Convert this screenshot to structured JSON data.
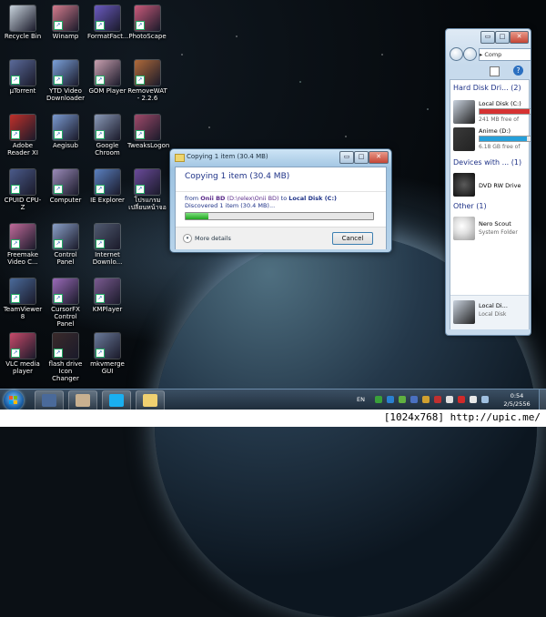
{
  "desktop": {
    "icons": [
      {
        "label": "Recycle Bin",
        "color": "#c8d3dc",
        "icon": "recycle-bin-icon"
      },
      {
        "label": "Winamp",
        "color": "#d37b8c",
        "icon": "winamp-icon"
      },
      {
        "label": "FormatFact...",
        "color": "#6a5ac0",
        "icon": "format-factory-icon"
      },
      {
        "label": "PhotoScape",
        "color": "#c95a7a",
        "icon": "photoscape-icon"
      },
      {
        "label": "µTorrent",
        "color": "#5a6a9a",
        "icon": "utorrent-icon"
      },
      {
        "label": "YTD Video Downloader",
        "color": "#7aa0d8",
        "icon": "ytd-icon"
      },
      {
        "label": "GOM Player",
        "color": "#c9a0b0",
        "icon": "gom-player-icon"
      },
      {
        "label": "RemoveWAT - 2.2.6",
        "color": "#b06a3a",
        "icon": "removewat-icon"
      },
      {
        "label": "Adobe Reader XI",
        "color": "#c0302a",
        "icon": "adobe-reader-icon"
      },
      {
        "label": "Aegisub",
        "color": "#7a9ad0",
        "icon": "aegisub-icon"
      },
      {
        "label": "Google Chroom",
        "color": "#8a9ab8",
        "icon": "google-chrome-icon"
      },
      {
        "label": "TweaksLogon",
        "color": "#a04a6a",
        "icon": "tweakslogon-icon"
      },
      {
        "label": "CPUID CPU-Z",
        "color": "#4a5a8a",
        "icon": "cpuz-icon"
      },
      {
        "label": "Computer",
        "color": "#9a8ab8",
        "icon": "computer-icon"
      },
      {
        "label": "IE Explorer",
        "color": "#5a80c0",
        "icon": "ie-explorer-icon"
      },
      {
        "label": "โปรแกรม เปลี่ยนหน้าจอ",
        "color": "#6a4a9a",
        "icon": "thai-program-icon"
      },
      {
        "label": "Freemake Video C...",
        "color": "#c06a9a",
        "icon": "freemake-icon"
      },
      {
        "label": "Control Panel",
        "color": "#8aa0c8",
        "icon": "control-panel-icon"
      },
      {
        "label": "Internet Downlo...",
        "color": "#505a70",
        "icon": "idm-icon"
      },
      {
        "label": "",
        "color": "",
        "icon": ""
      },
      {
        "label": "TeamViewer 8",
        "color": "#4a6a9a",
        "icon": "teamviewer-icon"
      },
      {
        "label": "CursorFX Control Panel",
        "color": "#9a6ab8",
        "icon": "cursorfx-icon"
      },
      {
        "label": "KMPlayer",
        "color": "#7a5a90",
        "icon": "kmplayer-icon"
      },
      {
        "label": "",
        "color": "",
        "icon": ""
      },
      {
        "label": "VLC media player",
        "color": "#c84a6a",
        "icon": "vlc-icon"
      },
      {
        "label": "flash drive Icon Changer",
        "color": "#3a2a2a",
        "icon": "flash-drive-icon"
      },
      {
        "label": "mkvmerge GUI",
        "color": "#6a7a9a",
        "icon": "mkvmerge-icon"
      }
    ]
  },
  "copy_dialog": {
    "title": "Copying 1 item (30.4 MB)",
    "heading": "Copying 1 item (30.4 MB)",
    "from_prefix": "from ",
    "source_name": "Onii BD",
    "source_path": " (D:\\relex\\Onii BD)",
    "to_word": " to ",
    "dest": "Local Disk (C:)",
    "discovered": "Discovered 1 item (30.4 MB)...",
    "progress_percent": 12,
    "more_details": "More details",
    "cancel": "Cancel",
    "minimize_glyph": "▭",
    "maximize_glyph": "□",
    "close_glyph": "✕"
  },
  "explorer": {
    "address": "▸ Comp",
    "hard_disk_group": "Hard Disk Dri... (2)",
    "drives": [
      {
        "name": "Local Disk (C:)",
        "free": "241 MB free of",
        "used_percent": 98,
        "bar_color": "#d63232",
        "thumb": "#c9d2de"
      },
      {
        "name": "Anime (D:)",
        "free": "6.18 GB free of",
        "used_percent": 92,
        "bar_color": "#26a0da",
        "thumb": "#3a3a3a"
      }
    ],
    "removable_group": "Devices with ... (1)",
    "dvd": {
      "name": "DVD RW Drive",
      "thumb": "#5a5a5a"
    },
    "other_group": "Other (1)",
    "nero": {
      "name": "Nero Scout",
      "sub": "System Folder",
      "thumb": "#e0e0e0"
    },
    "details": {
      "name": "Local Di...",
      "sub": "Local Disk",
      "thumb": "#c9d2de"
    }
  },
  "taskbar": {
    "lang": "EN",
    "time": "0:54",
    "date": "2/5/2556",
    "buttons": [
      {
        "icon": "media-icon",
        "color": "#4a6a9a"
      },
      {
        "icon": "paint-icon",
        "color": "#c8b090"
      },
      {
        "icon": "skype-icon",
        "color": "#1aaff0"
      },
      {
        "icon": "folder-icon",
        "color": "#f0d070"
      }
    ],
    "tray_icons": [
      {
        "icon": "tray-green-icon",
        "color": "#3aa03a"
      },
      {
        "icon": "tray-network-icon",
        "color": "#2a80d0"
      },
      {
        "icon": "tray-green2-icon",
        "color": "#60b040"
      },
      {
        "icon": "tray-blue-icon",
        "color": "#4a70c0"
      },
      {
        "icon": "tray-shield-icon",
        "color": "#d0a030"
      },
      {
        "icon": "tray-red-icon",
        "color": "#c03030"
      },
      {
        "icon": "tray-flag-icon",
        "color": "#e0e0e0"
      },
      {
        "icon": "tray-red2-icon",
        "color": "#d02a2a"
      },
      {
        "icon": "tray-volume-icon",
        "color": "#e8e8e8"
      },
      {
        "icon": "tray-monitor-icon",
        "color": "#a0c0e0"
      }
    ]
  },
  "watermark": "[1024x768] http://upic.me/"
}
